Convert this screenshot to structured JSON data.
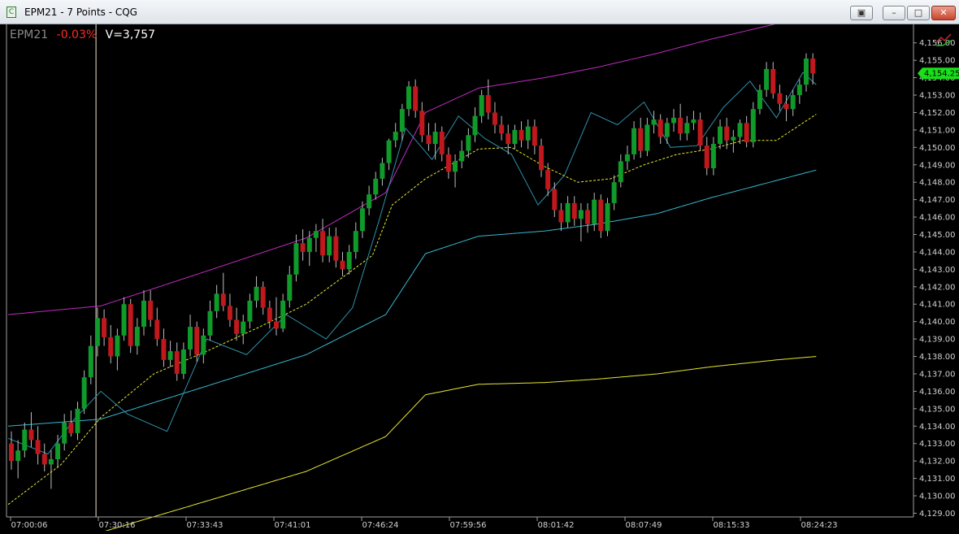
{
  "window": {
    "title": "EPM21 - 7 Points - CQG",
    "app_icon": "cqg-app-icon",
    "buttons": [
      {
        "name": "restore-icon",
        "glyph": "▣"
      },
      {
        "name": "minimize-icon",
        "glyph": "–"
      },
      {
        "name": "maximize-icon",
        "glyph": "□"
      },
      {
        "name": "close-icon",
        "glyph": "✕"
      }
    ]
  },
  "header": {
    "symbol": "EPM21",
    "change": "-0.03%",
    "volume": "V=3,757"
  },
  "colors": {
    "up_candle": "#0f9a2a",
    "down_candle": "#c0181c",
    "upper_band": "#c02cc0",
    "lower_band": "#e8e830",
    "middle_band": "#37b9d1",
    "moving_average": "#e8e830",
    "oscillator": "#2f8fa8",
    "last_price_tag": "#19e019",
    "crosshair": "#f4e8d0"
  },
  "chart_data": {
    "type": "candlestick",
    "y_ticks": [
      "4,156.00",
      "4,155.00",
      "4,154.00",
      "4,153.00",
      "4,152.00",
      "4,151.00",
      "4,150.00",
      "4,149.00",
      "4,148.00",
      "4,147.00",
      "4,146.00",
      "4,145.00",
      "4,144.00",
      "4,143.00",
      "4,142.00",
      "4,141.00",
      "4,140.00",
      "4,139.00",
      "4,138.00",
      "4,137.00",
      "4,136.00",
      "4,135.00",
      "4,134.00",
      "4,133.00",
      "4,132.00",
      "4,131.00",
      "4,130.00",
      "4,129.00"
    ],
    "x_ticks": [
      "07:00:06",
      "07:30:16",
      "07:33:43",
      "07:41:01",
      "07:46:24",
      "07:59:56",
      "08:01:42",
      "08:07:49",
      "08:15:33",
      "08:24:23"
    ],
    "ylim": [
      4128.6,
      4156.5
    ],
    "last_price": "4,154.25",
    "crosshair_index": 14,
    "candles": [
      [
        4133,
        4133.7,
        4131.5,
        4132
      ],
      [
        4132,
        4133.2,
        4131,
        4132.6
      ],
      [
        4132.6,
        4134.2,
        4132.2,
        4133.8
      ],
      [
        4133.8,
        4134.8,
        4132.8,
        4133.2
      ],
      [
        4133.2,
        4134,
        4131.8,
        4132.4
      ],
      [
        4132.4,
        4133,
        4131.4,
        4131.8
      ],
      [
        4131.8,
        4132.6,
        4130.4,
        4132.1
      ],
      [
        4132.1,
        4133.5,
        4131.6,
        4133
      ],
      [
        4133,
        4134.7,
        4132.6,
        4134.2
      ],
      [
        4134.2,
        4134.9,
        4133.4,
        4133.6
      ],
      [
        4133.6,
        4135.4,
        4133.2,
        4135
      ],
      [
        4135,
        4137.2,
        4134.7,
        4136.8
      ],
      [
        4136.8,
        4139.2,
        4136.4,
        4138.6
      ],
      [
        4138.6,
        4140.8,
        4138,
        4140.2
      ],
      [
        4140.2,
        4140.7,
        4138.6,
        4139.1
      ],
      [
        4139.1,
        4139.8,
        4137.6,
        4138
      ],
      [
        4138,
        4139.6,
        4137.2,
        4139.2
      ],
      [
        4139.2,
        4141.4,
        4138.9,
        4141
      ],
      [
        4141,
        4141.3,
        4138.2,
        4138.6
      ],
      [
        4138.6,
        4140.2,
        4138.1,
        4139.7
      ],
      [
        4139.7,
        4141.8,
        4139.2,
        4141.2
      ],
      [
        4141.2,
        4141.8,
        4139.7,
        4140.1
      ],
      [
        4140.1,
        4140.8,
        4138.6,
        4139
      ],
      [
        4139,
        4139.6,
        4137.4,
        4137.8
      ],
      [
        4137.8,
        4138.9,
        4137.4,
        4138.3
      ],
      [
        4138.3,
        4138.8,
        4136.6,
        4137
      ],
      [
        4137,
        4138.8,
        4136.7,
        4138.4
      ],
      [
        4138.4,
        4140.4,
        4138,
        4139.7
      ],
      [
        4139.7,
        4140,
        4137.7,
        4138.1
      ],
      [
        4138.1,
        4139.6,
        4137.6,
        4139.2
      ],
      [
        4139.2,
        4141.2,
        4138.9,
        4140.6
      ],
      [
        4140.6,
        4142.1,
        4140.2,
        4141.6
      ],
      [
        4141.6,
        4142.8,
        4140.6,
        4140.9
      ],
      [
        4140.9,
        4141.6,
        4139.7,
        4140.1
      ],
      [
        4140.1,
        4140.8,
        4138.9,
        4139.3
      ],
      [
        4139.3,
        4140.4,
        4138.7,
        4140
      ],
      [
        4140,
        4141.6,
        4139.6,
        4141.2
      ],
      [
        4141.2,
        4142.6,
        4140.8,
        4142
      ],
      [
        4142,
        4142.3,
        4140.4,
        4140.8
      ],
      [
        4140.8,
        4141.2,
        4139.6,
        4140
      ],
      [
        4140,
        4141.4,
        4139.2,
        4139.6
      ],
      [
        4139.6,
        4141.6,
        4139.4,
        4141.2
      ],
      [
        4141.2,
        4143.2,
        4140.8,
        4142.7
      ],
      [
        4142.7,
        4145,
        4142.3,
        4144.5
      ],
      [
        4144.5,
        4145.3,
        4143.5,
        4144
      ],
      [
        4144,
        4145.2,
        4143.2,
        4144.8
      ],
      [
        4144.8,
        4145.6,
        4144,
        4145.2
      ],
      [
        4145.2,
        4145.9,
        4143.4,
        4143.8
      ],
      [
        4143.8,
        4145.4,
        4143.4,
        4144.9
      ],
      [
        4144.9,
        4145.4,
        4143.1,
        4143.5
      ],
      [
        4143.5,
        4144,
        4142.6,
        4143
      ],
      [
        4143,
        4144.4,
        4142.7,
        4144
      ],
      [
        4144,
        4145.7,
        4143.6,
        4145.2
      ],
      [
        4145.2,
        4146.9,
        4144.8,
        4146.5
      ],
      [
        4146.5,
        4147.8,
        4146.1,
        4147.3
      ],
      [
        4147.3,
        4148.6,
        4147,
        4148.2
      ],
      [
        4148.2,
        4149.4,
        4147.8,
        4149.1
      ],
      [
        4149.1,
        4150.5,
        4148.7,
        4150.4
      ],
      [
        4150.4,
        4151.4,
        4150,
        4150.9
      ],
      [
        4150.9,
        4152.5,
        4150.4,
        4152.2
      ],
      [
        4152.2,
        4153.8,
        4151.8,
        4153.5
      ],
      [
        4153.5,
        4153.9,
        4151.7,
        4152.1
      ],
      [
        4152.1,
        4152.6,
        4150.3,
        4150.7
      ],
      [
        4150.7,
        4151.4,
        4149.8,
        4150.2
      ],
      [
        4150.2,
        4151.4,
        4149.3,
        4150.9
      ],
      [
        4150.9,
        4151.2,
        4149.2,
        4149.6
      ],
      [
        4149.6,
        4150,
        4148.2,
        4148.6
      ],
      [
        4148.6,
        4149.6,
        4147.7,
        4149.2
      ],
      [
        4149.2,
        4150.4,
        4148.8,
        4149.8
      ],
      [
        4149.8,
        4151.1,
        4149.4,
        4150.7
      ],
      [
        4150.7,
        4152.3,
        4150.3,
        4151.8
      ],
      [
        4151.8,
        4153.3,
        4151.4,
        4153
      ],
      [
        4153,
        4153.9,
        4151.6,
        4152
      ],
      [
        4152,
        4152.6,
        4150.8,
        4151.3
      ],
      [
        4151.3,
        4151.8,
        4150.4,
        4150.8
      ],
      [
        4150.8,
        4151.3,
        4149.6,
        4150.2
      ],
      [
        4150.2,
        4151.3,
        4149.9,
        4151
      ],
      [
        4151,
        4151.5,
        4150,
        4150.4
      ],
      [
        4150.4,
        4151.6,
        4149.9,
        4151.2
      ],
      [
        4151.2,
        4151.6,
        4149.6,
        4150.1
      ],
      [
        4150.1,
        4150.5,
        4148.3,
        4148.7
      ],
      [
        4148.7,
        4149.1,
        4147.2,
        4147.6
      ],
      [
        4147.6,
        4148,
        4146,
        4146.4
      ],
      [
        4146.4,
        4146.8,
        4145.2,
        4145.7
      ],
      [
        4145.7,
        4147.2,
        4145.4,
        4146.8
      ],
      [
        4146.8,
        4147.2,
        4145.5,
        4145.9
      ],
      [
        4145.9,
        4146.8,
        4144.6,
        4146.4
      ],
      [
        4146.4,
        4146.8,
        4145.1,
        4145.6
      ],
      [
        4145.6,
        4147.4,
        4145.2,
        4147
      ],
      [
        4147,
        4147.3,
        4144.8,
        4145.2
      ],
      [
        4145.2,
        4147.1,
        4144.9,
        4146.8
      ],
      [
        4146.8,
        4148.4,
        4146.4,
        4148
      ],
      [
        4148,
        4149.6,
        4147.7,
        4149.2
      ],
      [
        4149.2,
        4150.1,
        4148.7,
        4149.6
      ],
      [
        4149.6,
        4151.5,
        4149.3,
        4151.1
      ],
      [
        4151.1,
        4151.7,
        4149.4,
        4149.8
      ],
      [
        4149.8,
        4151.7,
        4149.5,
        4151.3
      ],
      [
        4151.3,
        4152.1,
        4150.8,
        4151.6
      ],
      [
        4151.6,
        4151.9,
        4150.2,
        4150.6
      ],
      [
        4150.6,
        4151.7,
        4150.2,
        4151.4
      ],
      [
        4151.4,
        4152.2,
        4150.9,
        4151.7
      ],
      [
        4151.7,
        4152.5,
        4150.4,
        4150.8
      ],
      [
        4150.8,
        4151.8,
        4150.4,
        4151.4
      ],
      [
        4151.4,
        4152.1,
        4151,
        4151.6
      ],
      [
        4151.6,
        4152,
        4149.8,
        4150.1
      ],
      [
        4150.1,
        4150.6,
        4148.4,
        4148.8
      ],
      [
        4148.8,
        4150.6,
        4148.4,
        4150.2
      ],
      [
        4150.2,
        4151.6,
        4149.9,
        4151.2
      ],
      [
        4151.2,
        4151.7,
        4149.9,
        4150.4
      ],
      [
        4150.4,
        4151,
        4149.7,
        4150.6
      ],
      [
        4150.6,
        4151.6,
        4150.2,
        4151.4
      ],
      [
        4151.4,
        4151.8,
        4150,
        4150.3
      ],
      [
        4150.3,
        4152.6,
        4150,
        4152.2
      ],
      [
        4152.2,
        4153.6,
        4151.9,
        4153.3
      ],
      [
        4153.3,
        4154.9,
        4152.9,
        4154.5
      ],
      [
        4154.5,
        4154.9,
        4152.8,
        4153.1
      ],
      [
        4153.1,
        4153.6,
        4152.1,
        4152.5
      ],
      [
        4152.5,
        4153,
        4151.5,
        4152.2
      ],
      [
        4152.2,
        4153.3,
        4151.8,
        4153
      ],
      [
        4153,
        4153.9,
        4152.5,
        4153.6
      ],
      [
        4153.6,
        4155.4,
        4153.2,
        4155.1
      ],
      [
        4155.1,
        4155.4,
        4153.6,
        4154.25
      ]
    ],
    "band_anchors_x": [
      0,
      14,
      30,
      45,
      57,
      63,
      71,
      81,
      89,
      98,
      106,
      116,
      122
    ],
    "upper_band": [
      4140.4,
      4140.9,
      4142.9,
      4144.8,
      4147.4,
      4152,
      4153.4,
      4154,
      4154.6,
      4155.4,
      4156.2,
      4157.1,
      4157.7
    ],
    "middle_band": [
      4134,
      4134.4,
      4136.3,
      4138.1,
      4140.4,
      4143.9,
      4144.9,
      4145.2,
      4145.6,
      4146.2,
      4147.1,
      4148.1,
      4148.7
    ],
    "lower_band": [
      4127.6,
      4127.9,
      4129.7,
      4131.4,
      4133.4,
      4135.8,
      4136.4,
      4136.5,
      4136.7,
      4137,
      4137.4,
      4137.8,
      4138
    ],
    "ma_anchors_x": [
      0,
      8,
      14,
      22,
      30,
      38,
      45,
      50,
      55,
      58,
      63,
      71,
      76,
      81,
      86,
      91,
      96,
      101,
      106,
      111,
      116,
      122
    ],
    "moving_average": [
      4129.5,
      4131.8,
      4134.5,
      4137,
      4138.3,
      4139.7,
      4141,
      4142.4,
      4143.8,
      4146.7,
      4148.2,
      4149.9,
      4150,
      4148.9,
      4148,
      4148.2,
      4149,
      4149.6,
      4149.9,
      4150.4,
      4150.4,
      4151.9
    ],
    "oscillator_anchors_x": [
      0,
      6,
      10,
      14,
      18,
      24,
      30,
      36,
      42,
      48,
      52,
      56,
      60,
      64,
      68,
      72,
      76,
      80,
      84,
      88,
      92,
      96,
      100,
      104,
      108,
      112,
      116,
      120,
      122
    ],
    "oscillator": [
      4133.3,
      4132.4,
      4134.4,
      4136,
      4134.7,
      4133.7,
      4139,
      4138.1,
      4140.4,
      4139,
      4140.8,
      4145.8,
      4151.1,
      4149.3,
      4151.8,
      4150.5,
      4149.6,
      4146.7,
      4148.4,
      4152,
      4151.3,
      4152.6,
      4150,
      4150.1,
      4152.3,
      4153.8,
      4151.7,
      4154.3,
      4153.6
    ]
  }
}
